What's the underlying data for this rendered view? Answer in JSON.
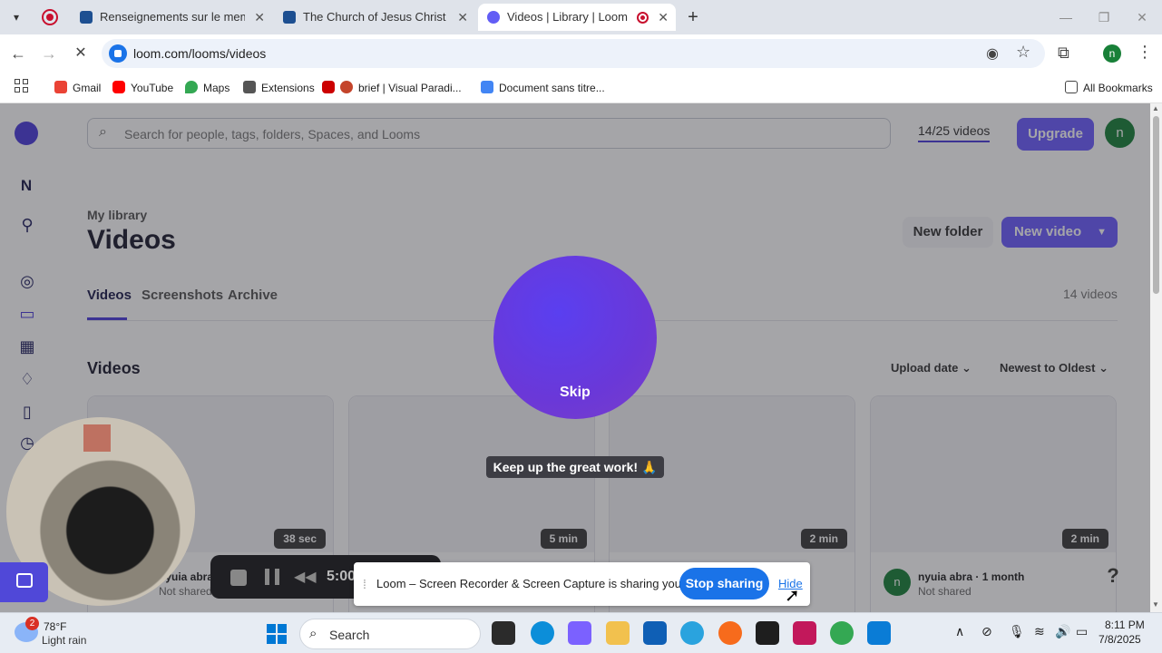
{
  "browser": {
    "tabs": [
      {
        "title": "Renseignements sur le membre",
        "favicon_color": "#1d4f91"
      },
      {
        "title": "The Church of Jesus Christ of Latter-day Saints",
        "favicon_color": "#1d4f91"
      },
      {
        "title": "Videos | Library | Loom",
        "favicon_color": "#625df5"
      }
    ],
    "url": "loom.com/looms/videos",
    "bookmarks": [
      "Gmail",
      "YouTube",
      "Maps",
      "Extensions",
      "brief | Visual Paradi...",
      "Document sans titre..."
    ],
    "all_bookmarks": "All Bookmarks",
    "profile_initial": "n"
  },
  "loom": {
    "search_placeholder": "Search for people, tags, folders, Spaces, and Looms",
    "quota": "14/25 videos",
    "upgrade": "Upgrade",
    "avatar_initial": "n",
    "workspace_initial": "N",
    "breadcrumb": "My library",
    "title": "Videos",
    "new_folder": "New folder",
    "new_video": "New video",
    "tabs": [
      "Videos",
      "Screenshots",
      "Archive"
    ],
    "count": "14 videos",
    "section": "Videos",
    "sort_date": "Upload date",
    "sort_order": "Newest to Oldest",
    "cards": [
      {
        "duration": "38 sec",
        "author": "nyuia abra",
        "meta": "Not shared"
      },
      {
        "duration": "5 min",
        "author": "",
        "meta": ""
      },
      {
        "duration": "2 min",
        "author": "",
        "meta": ""
      },
      {
        "duration": "2 min",
        "author": "nyuia abra · 1 month",
        "meta": "Not shared"
      }
    ],
    "help": "?"
  },
  "recorder": {
    "skip": "Skip",
    "toast": "Keep up the great work! 🙏",
    "timer": "5:00"
  },
  "sharebar": {
    "message": "Loom – Screen Recorder & Screen Capture is sharing your screen.",
    "stop": "Stop sharing",
    "hide": "Hide"
  },
  "taskbar": {
    "weather_temp": "78°F",
    "weather_desc": "Light rain",
    "weather_badge": "2",
    "search": "Search",
    "time": "8:11 PM",
    "date": "7/8/2025"
  }
}
